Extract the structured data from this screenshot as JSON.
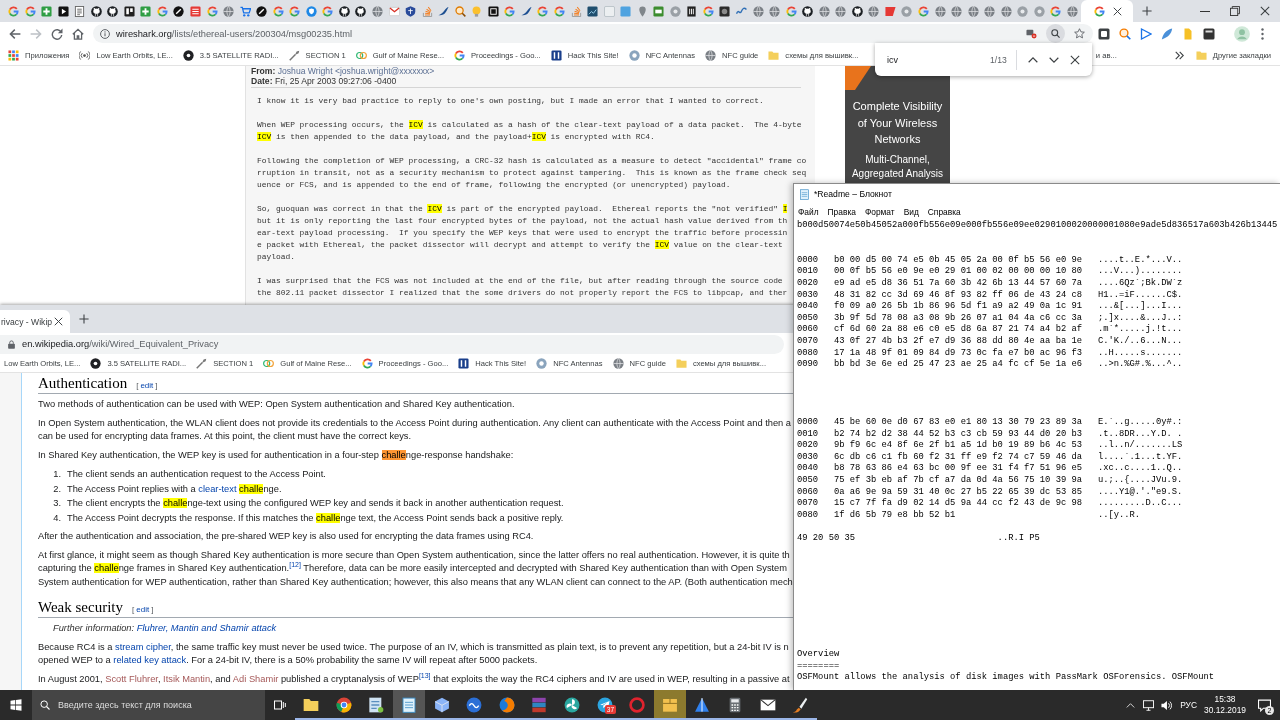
{
  "browser": {
    "tabs": [
      {
        "selected": false
      },
      {
        "selected": false
      },
      {
        "selected": false
      },
      {
        "selected": false
      },
      {
        "selected": false
      },
      {
        "selected": false
      },
      {
        "selected": false
      },
      {
        "selected": false
      },
      {
        "selected": false
      },
      {
        "selected": false
      },
      {
        "selected": false
      },
      {
        "selected": false
      },
      {
        "selected": false
      },
      {
        "selected": false
      },
      {
        "selected": false
      },
      {
        "selected": false
      },
      {
        "selected": false
      },
      {
        "selected": false
      },
      {
        "selected": false
      },
      {
        "selected": false
      },
      {
        "selected": false
      },
      {
        "selected": false
      },
      {
        "selected": false
      },
      {
        "selected": false
      },
      {
        "selected": false
      },
      {
        "selected": false
      },
      {
        "selected": false
      },
      {
        "selected": false
      },
      {
        "selected": false
      },
      {
        "selected": false
      },
      {
        "selected": false
      },
      {
        "selected": false
      },
      {
        "selected": false
      },
      {
        "selected": false
      },
      {
        "selected": false
      },
      {
        "selected": false
      },
      {
        "selected": false
      },
      {
        "selected": false
      },
      {
        "selected": false
      },
      {
        "selected": false
      },
      {
        "selected": false
      },
      {
        "selected": false
      },
      {
        "selected": false
      },
      {
        "selected": false
      },
      {
        "selected": false
      },
      {
        "selected": false
      },
      {
        "selected": false
      },
      {
        "selected": false
      },
      {
        "selected": false
      },
      {
        "selected": false
      },
      {
        "selected": false
      },
      {
        "selected": false
      },
      {
        "selected": false
      },
      {
        "selected": false
      },
      {
        "selected": false
      },
      {
        "selected": false
      },
      {
        "selected": false
      },
      {
        "selected": false
      },
      {
        "selected": false
      },
      {
        "selected": false
      },
      {
        "selected": false
      },
      {
        "selected": false
      },
      {
        "selected": false
      },
      {
        "selected": false
      },
      {
        "selected": false
      },
      {
        "selected": true
      }
    ],
    "address": {
      "host": "wireshark.org",
      "path": "/lists/ethereal-users/200304/msg00235.html"
    },
    "bookmarks": [
      {
        "label": "Приложения"
      },
      {
        "label": "Low Earth Orbits, LE..."
      },
      {
        "label": "3.5 SATELLITE RADI..."
      },
      {
        "label": "SECTION 1"
      },
      {
        "label": "Gulf of Maine Rese..."
      },
      {
        "label": "Proceedings - Goo..."
      },
      {
        "label": "Hack This Site!"
      },
      {
        "label": "NFC Antennas"
      },
      {
        "label": "NFC guide"
      },
      {
        "label": "схемы для вышивк..."
      }
    ],
    "partly_hidden_bookmark": "и ав...",
    "other_bookmarks": "Другие закладки",
    "find_bar": {
      "query": "icv",
      "count": "1/13"
    },
    "page": {
      "from": "**From:** Joshua Wright <joshua.wright@xxxxxxx>",
      "date": "**Date:** Fri, 25 Apr 2003 09:27:06 -0400",
      "paragraphs": [
        {
          "lines": [
            "I know it is very bad practice to reply to one's own posting, but I made an error that I wanted to correct."
          ]
        },
        {
          "lines": [
            [
              "When WEP processing occurs, the ",
              {
                "kind": "match",
                "text": "ICV"
              },
              " is calculated as a hash of the clear-text payload of a data packet.  The 4-byte"
            ],
            [
              {
                "kind": "match",
                "text": "ICV"
              },
              " is then appended to the data payload, and the payload+",
              {
                "kind": "match",
                "text": "ICV"
              },
              " is encrypted with RC4."
            ]
          ]
        },
        {
          "lines": [
            "Following the completion of WEP processing, a CRC-32 hash is calculated as a measure to detect \"accidental\" frame co",
            "rruption in transit, not as a security mechanism to protect against tampering.  This is known as the frame check seq",
            "uence or FCS, and is appended to the end of frame, following the encrypted (or unencrypted) payload."
          ]
        },
        {
          "lines": [
            [
              "So, guoquan was correct in that the ",
              {
                "kind": "match",
                "text": "ICV"
              },
              " is part of the encrypted payload.  Ethereal reports the \"not verified\" ",
              {
                "kind": "match",
                "text": "I"
              }
            ],
            "but it is only reporting the last four encrypted bytes of the payload, not the actual hash value derived from th",
            "ear-text payload processing.  If you specify the WEP keys that were used to encrypt the traffic before processin",
            [
              "e packet with Ethereal, the packet dissector will decrypt and attempt to verify the ",
              {
                "kind": "match",
                "text": "ICV"
              },
              " value on the clear-text"
            ],
            "payload."
          ]
        },
        {
          "lines": [
            "I was surprised that the FCS was not included at the end of the file, but after reading through the source code",
            "the 802.11 packet dissector I realized that the some drivers do not properly report the FCS to libpcap, and ther"
          ]
        }
      ]
    },
    "ad": {
      "headline": [
        "Complete Visibility",
        "of Your Wireless",
        "Networks"
      ],
      "subline": [
        "Multi-Channel,",
        "Aggregated Analysis"
      ]
    }
  },
  "wiki_window": {
    "tab": {
      "title": "rivacy - Wikip",
      "selected": true
    },
    "address": {
      "host": "en.wikipedia.org",
      "path": "/wiki/Wired_Equivalent_Privacy"
    },
    "bookmarks": [
      {
        "label": "Low Earth Orbits, LE..."
      },
      {
        "label": "3.5 SATELLITE RADI..."
      },
      {
        "label": "SECTION 1"
      },
      {
        "label": "Gulf of Maine Rese..."
      },
      {
        "label": "Proceedings - Goo..."
      },
      {
        "label": "Hack This Site!"
      },
      {
        "label": "NFC Antennas"
      },
      {
        "label": "NFC guide"
      },
      {
        "label": "схемы для вышивк..."
      }
    ],
    "article": [
      {
        "kind": "heading",
        "text": "Authentication",
        "edit": {
          "open": "[",
          "label": "edit",
          "close": "]"
        }
      },
      {
        "kind": "paragraph",
        "lines": [
          "Two methods of authentication can be used with WEP: Open System authentication and Shared Key authentication."
        ]
      },
      {
        "kind": "paragraph",
        "lines": [
          "In Open System authentication, the WLAN client does not provide its credentials to the Access Point during authentication. Any client can authenticate with the Access Point and then a",
          "can be used for encrypting data frames. At this point, the client must have the correct keys."
        ]
      },
      {
        "kind": "paragraph",
        "lines": [
          [
            "In Shared Key authentication, the WEP key is used for authentication in a four-step ",
            {
              "kind": "current",
              "text": "challe"
            },
            "nge-response handshake:"
          ]
        ]
      },
      {
        "kind": "list",
        "items": [
          {
            "number": "1.",
            "lines": [
              "The client sends an authentication request to the Access Point."
            ]
          },
          {
            "number": "2.",
            "lines": [
              [
                "The Access Point replies with a ",
                {
                  "kind": "link",
                  "text": "clear-text "
                },
                {
                  "kind": "match",
                  "text": "challe"
                },
                "nge."
              ]
            ]
          },
          {
            "number": "3.",
            "lines": [
              [
                "The client encrypts the ",
                {
                  "kind": "match",
                  "text": "challe"
                },
                "nge-text using the configured WEP key and sends it back in another authentication request."
              ]
            ]
          },
          {
            "number": "4.",
            "lines": [
              [
                "The Access Point decrypts the response. If this matches the ",
                {
                  "kind": "match",
                  "text": "challe"
                },
                "nge text, the Access Point sends back a positive reply."
              ]
            ]
          }
        ]
      },
      {
        "kind": "paragraph",
        "lines": [
          "After the authentication and association, the pre-shared WEP key is also used for encrypting the data frames using RC4."
        ]
      },
      {
        "kind": "paragraph",
        "lines": [
          "At first glance, it might seem as though Shared Key authentication is more secure than Open System authentication, since the latter offers no real authentication. However, it is quite th",
          [
            "capturing the ",
            {
              "kind": "match",
              "text": "challe"
            },
            "nge frames in Shared Key authentication.",
            {
              "kind": "ref",
              "text": "[12]"
            },
            " Therefore, data can be more easily intercepted and decrypted with Shared Key authentication than with Open System"
          ],
          "System authentication for WEP authentication, rather than Shared Key authentication; however, this also means that any WLAN client can connect to the AP. (Both authentication mech"
        ]
      },
      {
        "kind": "heading",
        "text": "Weak security",
        "edit": {
          "open": "[",
          "label": "edit",
          "close": "]"
        }
      },
      {
        "kind": "note",
        "lines": [
          [
            "Further information: ",
            {
              "kind": "link",
              "text": "Fluhrer, Mantin and Shamir attack"
            }
          ]
        ]
      },
      {
        "kind": "paragraph",
        "lines": [
          [
            "Because RC4 is a ",
            {
              "kind": "link",
              "text": "stream cipher"
            },
            ", the same traffic key must never be used twice. The purpose of an IV, which is transmitted as plain text, is to prevent any repetition, but a 24-bit IV is n"
          ],
          [
            "opened WEP to a ",
            {
              "kind": "link",
              "text": "related key attack"
            },
            ". For a 24-bit IV, there is a 50% probability the same IV will repeat after 5000 packets."
          ]
        ]
      },
      {
        "kind": "paragraph",
        "lines": [
          [
            "In August 2001, ",
            {
              "kind": "visited",
              "text": "Scott Fluhrer"
            },
            ", ",
            {
              "kind": "visited",
              "text": "Itsik Mantin"
            },
            ", and ",
            {
              "kind": "visited",
              "text": "Adi Shamir"
            },
            " published a cryptanalysis of WEP",
            {
              "kind": "ref",
              "text": "[13]"
            },
            " that exploits the way the RC4 ciphers and IV are used in WEP, resulting in a passive at"
          ]
        ]
      }
    ]
  },
  "notepad": {
    "title": "*Readme – Блокнот",
    "menu": [
      "Файл",
      "Правка",
      "Формат",
      "Вид",
      "Справка"
    ],
    "text": "b000d50074e50b45052a000fb556e09e000fb556e09ee0290100020000001080e9ade5d836517a603b426b13445\n\n\n0000   b0 00 d5 00 74 e5 0b 45 05 2a 00 0f b5 56 e0 9e   ....t..E.*...V..\n0010   00 0f b5 56 e0 9e e0 29 01 00 02 00 00 00 10 80   ...V...)........\n0020   e9 ad e5 d8 36 51 7a 60 3b 42 6b 13 44 57 60 7a   ....6Qz`;Bk.DW`z\n0030   48 31 82 cc 3d 69 46 8f 93 82 ff 06 de 43 24 c8   H1..=iF......C$.\n0040   f0 09 a0 26 5b 1b 86 96 5d f1 a9 a2 49 0a 1c 91   ...&[...]...I...\n0050   3b 9f 5d 78 08 a3 08 9b 26 07 a1 04 4a c6 cc 3a   ;.]x....&...J..:\n0060   cf 6d 60 2a 88 e6 c0 e5 d8 6a 87 21 74 a4 b2 af   .m`*.....j.!t...\n0070   43 0f 27 4b b3 2f e7 d9 36 88 dd 80 4e aa ba 1e   C.'K./..6...N...\n0080   17 1a 48 9f 01 09 84 d9 73 0c fa e7 b0 ac 96 f3   ..H.....s.......\n0090   bb bd 3e 6e ed 25 47 23 ae 25 a4 fc cf 5e 1a e6   ..>n.%G#.%...^..\n\n\n\n\n0000   45 be 60 0e d0 67 83 e0 e1 80 13 30 79 23 89 3a   E.`..g.....0y#.:\n0010   b2 74 b2 d2 38 44 52 b3 c3 cb 59 93 44 d0 20 b3   .t..8DR...Y.D. .\n0020   9b f9 6c e4 8f 6e 2f b1 a5 1d b0 19 89 b6 4c 53   ..l..n/.......LS\n0030   6c db c6 c1 fb 60 f2 31 ff e9 f2 74 c7 59 46 da   l....`.1...t.YF.\n0040   b8 78 63 86 e4 63 bc 00 9f ee 31 f4 f7 51 96 e5   .xc..c....1..Q..\n0050   75 ef 3b eb af 7b cf a7 da 0d 4a 56 75 10 39 9a   u.;..{....JVu.9.\n0060   0a a6 9e 9a 59 31 40 0c 27 b5 22 65 39 dc 53 85   ....Y1@.'.\"e9.S.\n0070   15 c7 7f fa d9 02 14 d5 9a 44 cc f2 43 de 9c 98   .........D..C...\n0080   1f d6 5b 79 e8 bb 52 b1                           ..[y..R.\n\n49 20 50 35                           ..R.I P5\n\n\n\n\n\n\n\n\n\nOverview\n========\nOSFMount allows the analysis of disk images with PassMark OSForensics. OSFMount"
  },
  "taskbar": {
    "search_placeholder": "Введите здесь текст для поиска",
    "apps": [
      {
        "running": true,
        "selected": false,
        "attention": false
      },
      {
        "running": true,
        "selected": false,
        "attention": false
      },
      {
        "running": true,
        "selected": false,
        "attention": false
      },
      {
        "running": true,
        "selected": true,
        "attention": false
      },
      {
        "running": true,
        "selected": false,
        "attention": false
      },
      {
        "running": true,
        "selected": false,
        "attention": false
      },
      {
        "running": true,
        "selected": false,
        "attention": false
      },
      {
        "running": true,
        "selected": false,
        "attention": false
      },
      {
        "running": true,
        "selected": false,
        "attention": false
      },
      {
        "running": true,
        "selected": false,
        "attention": false,
        "badge": "37"
      },
      {
        "running": true,
        "selected": false,
        "attention": false
      },
      {
        "running": true,
        "selected": false,
        "attention": true
      },
      {
        "running": true,
        "selected": false,
        "attention": false
      },
      {
        "running": true,
        "selected": false,
        "attention": false
      },
      {
        "running": true,
        "selected": false,
        "attention": false
      },
      {
        "running": true,
        "selected": false,
        "attention": false
      }
    ],
    "language": "РУС",
    "time": "15:38",
    "date": "30.12.2019",
    "notifications": "2"
  }
}
